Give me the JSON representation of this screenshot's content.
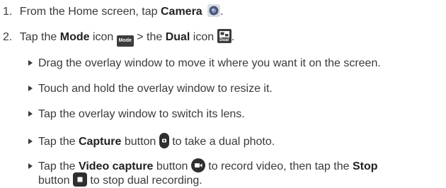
{
  "steps": [
    {
      "num": "1.",
      "t1": "From the Home screen, tap ",
      "b1": "Camera",
      "t2": ".",
      "icon": "camera-icon"
    },
    {
      "num": "2.",
      "t1": "Tap the ",
      "b1": "Mode",
      "t2": " icon ",
      "t3": " > the ",
      "b2": "Dual",
      "t4": " icon ",
      "t5": ".",
      "mode_icon_text": "Mode",
      "dual_icon_text": "Dual",
      "icons": [
        "mode-icon",
        "dual-icon"
      ]
    }
  ],
  "bullets": [
    {
      "t1": "Drag the overlay window to move it where you want it on the screen."
    },
    {
      "t1": "Touch and hold the overlay window to resize it."
    },
    {
      "t1": "Tap the overlay window to switch its lens."
    },
    {
      "t1": "Tap the ",
      "b1": "Capture",
      "t2": " button ",
      "t3": " to take a dual photo.",
      "icon": "capture-button-icon"
    },
    {
      "t1": "Tap the ",
      "b1": "Video capture",
      "t2": " button ",
      "t3": " to record video, then tap the ",
      "b2": "Stop",
      "t4": "button ",
      "t5": " to stop dual recording.",
      "icons": [
        "video-capture-icon",
        "stop-icon"
      ]
    }
  ]
}
